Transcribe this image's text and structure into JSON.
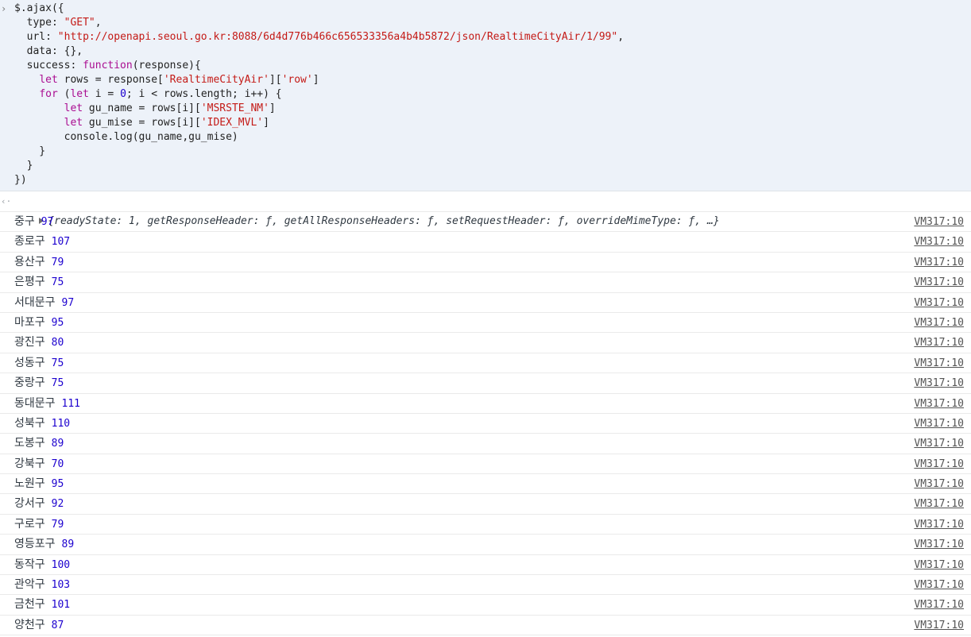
{
  "console": {
    "prompt_symbol": "›",
    "return_symbol": "‹·",
    "code_lines": [
      "$.ajax({",
      "  type: \"GET\",",
      "  url: \"http://openapi.seoul.go.kr:8088/6d4d776b466c656533356a4b4b5872/json/RealtimeCityAir/1/99\",",
      "  data: {},",
      "  success: function(response){",
      "    let rows = response['RealtimeCityAir']['row']",
      "    for (let i = 0; i < rows.length; i++) {",
      "        let gu_name = rows[i]['MSRSTE_NM']",
      "        let gu_mise = rows[i]['IDEX_MVL']",
      "        console.log(gu_name,gu_mise)",
      "    }",
      "  }",
      "})"
    ],
    "result_summary": "{readyState: 1, getResponseHeader: ƒ, getAllResponseHeaders: ƒ, setRequestHeader: ƒ, overrideMimeType: ƒ, …}",
    "logs": [
      {
        "name": "중구",
        "value": "97",
        "source": "VM317:10"
      },
      {
        "name": "종로구",
        "value": "107",
        "source": "VM317:10"
      },
      {
        "name": "용산구",
        "value": "79",
        "source": "VM317:10"
      },
      {
        "name": "은평구",
        "value": "75",
        "source": "VM317:10"
      },
      {
        "name": "서대문구",
        "value": "97",
        "source": "VM317:10"
      },
      {
        "name": "마포구",
        "value": "95",
        "source": "VM317:10"
      },
      {
        "name": "광진구",
        "value": "80",
        "source": "VM317:10"
      },
      {
        "name": "성동구",
        "value": "75",
        "source": "VM317:10"
      },
      {
        "name": "중랑구",
        "value": "75",
        "source": "VM317:10"
      },
      {
        "name": "동대문구",
        "value": "111",
        "source": "VM317:10"
      },
      {
        "name": "성북구",
        "value": "110",
        "source": "VM317:10"
      },
      {
        "name": "도봉구",
        "value": "89",
        "source": "VM317:10"
      },
      {
        "name": "강북구",
        "value": "70",
        "source": "VM317:10"
      },
      {
        "name": "노원구",
        "value": "95",
        "source": "VM317:10"
      },
      {
        "name": "강서구",
        "value": "92",
        "source": "VM317:10"
      },
      {
        "name": "구로구",
        "value": "79",
        "source": "VM317:10"
      },
      {
        "name": "영등포구",
        "value": "89",
        "source": "VM317:10"
      },
      {
        "name": "동작구",
        "value": "100",
        "source": "VM317:10"
      },
      {
        "name": "관악구",
        "value": "103",
        "source": "VM317:10"
      },
      {
        "name": "금천구",
        "value": "101",
        "source": "VM317:10"
      },
      {
        "name": "양천구",
        "value": "87",
        "source": "VM317:10"
      }
    ]
  },
  "colors": {
    "input_background": "#edf2f9",
    "keyword": "#aa0d91",
    "string": "#c41a16",
    "number": "#1c00cf",
    "link": "#545454"
  }
}
